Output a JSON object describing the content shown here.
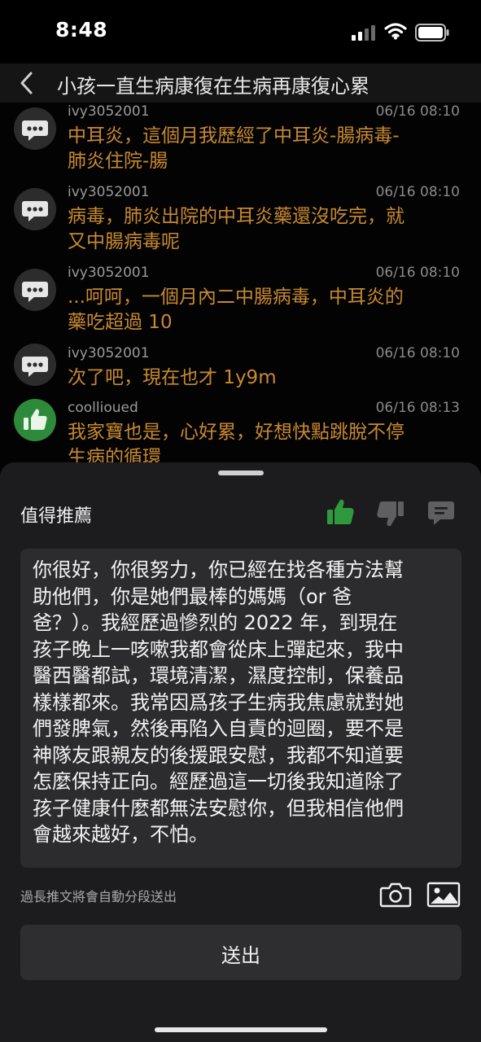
{
  "status_bar": {
    "time": "8:48",
    "signal_icon": "cellular-signal-icon",
    "wifi_icon": "wifi-icon",
    "battery_icon": "battery-icon"
  },
  "header": {
    "title": "小孩一直生病康復在生病再康復心累",
    "back_icon": "chevron-left-icon"
  },
  "comments": [
    {
      "user": "ivy3052001",
      "time": "06/16 08:10",
      "lines": [
        "中耳炎，這個月我歷經了中耳炎-腸病毒-",
        "肺炎住院-腸"
      ],
      "icon": "speech-bubble-icon"
    },
    {
      "user": "ivy3052001",
      "time": "06/16 08:10",
      "lines": [
        "病毒，肺炎出院的中耳炎藥還沒吃完，就",
        "又中腸病毒呢"
      ],
      "icon": "speech-bubble-icon"
    },
    {
      "user": "ivy3052001",
      "time": "06/16 08:10",
      "lines": [
        "...呵呵，一個月內二中腸病毒，中耳炎的",
        "藥吃超過 10"
      ],
      "icon": "speech-bubble-icon"
    },
    {
      "user": "ivy3052001",
      "time": "06/16 08:10",
      "lines": [
        "次了吧，現在也才 1y9m"
      ],
      "icon": "speech-bubble-icon"
    },
    {
      "user": "coollioued",
      "time": "06/16 08:13",
      "lines": [
        "我家寶也是，心好累，好想快點跳脫不停",
        "生病的循環"
      ],
      "icon": "thumbs-up-icon"
    }
  ],
  "sheet": {
    "recommend_label": "值得推薦",
    "vote_icons": [
      "thumbs-up-icon",
      "thumbs-down-icon",
      "comment-icon"
    ],
    "composer_lines": [
      "你很好，你很努力，你已經在找各種方法幫",
      "助他們，你是她們最棒的媽媽（or 爸",
      "爸？）。我經歷過慘烈的 2022 年，到現在",
      "孩子晚上一咳嗽我都會從床上彈起來，我中",
      "醫西醫都試，環境清潔，濕度控制，保養品",
      "樣樣都來。我常因爲孩子生病我焦慮就對她",
      "們發脾氣，然後再陷入自責的迴圈，要不是",
      "神隊友跟親友的後援跟安慰，我都不知道要",
      "怎麼保持正向。經歷過這一切後我知道除了",
      "孩子健康什麼都無法安慰你，但我相信他們",
      "會越來越好，不怕。"
    ],
    "note": "過長推文將會自動分段送出",
    "camera_icon": "camera-icon",
    "image_icon": "image-icon",
    "send_label": "送出"
  },
  "colors": {
    "accent_text": "#c8892f",
    "upvote_green": "#2e9a3e",
    "sheet_bg": "#1c1c1e"
  }
}
